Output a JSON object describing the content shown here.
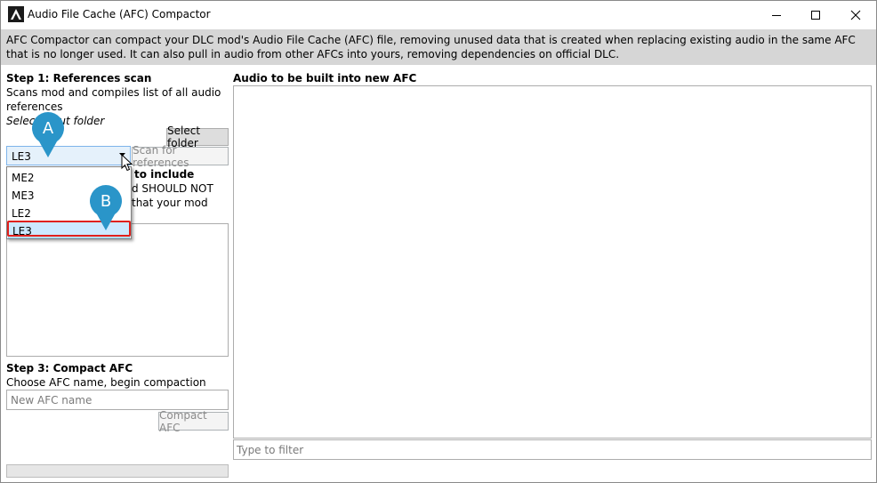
{
  "window": {
    "title": "Audio File Cache (AFC) Compactor",
    "controls": {
      "minimize": "minimize-icon",
      "maximize": "maximize-icon",
      "close": "close-icon"
    }
  },
  "banner": {
    "text": "AFC Compactor can compact your DLC mod's Audio File Cache (AFC) file, removing unused data that is created when replacing existing audio in the same AFC that is no longer used. It can also pull in audio from other AFCs into yours, removing dependencies on official DLC."
  },
  "step1": {
    "heading": "Step 1: References scan",
    "desc_line1": "Scans mod and compiles list of all audio",
    "desc_line2": "references",
    "select_input_folder": "Select input folder",
    "select_folder_button": "Select folder",
    "scan_button": "Scan for references",
    "game_selected": "LE3",
    "game_options": [
      "ME2",
      "ME3",
      "LE2",
      "LE3"
    ]
  },
  "step2": {
    "heading_partial": "to include",
    "line2_partial": "d SHOULD NOT",
    "line3_partial": "that your mod"
  },
  "step3": {
    "heading": "Step 3: Compact AFC",
    "desc": "Choose AFC name, begin compaction",
    "afc_name_placeholder": "New AFC name",
    "compact_button": "Compact AFC"
  },
  "right": {
    "heading": "Audio to be built into new AFC",
    "filter_placeholder": "Type to filter"
  },
  "annotations": {
    "marker_a": "A",
    "marker_b": "B",
    "marker_color": "#2a95c9",
    "highlight_color": "#e0201c"
  },
  "progress": {
    "fraction": 0
  }
}
